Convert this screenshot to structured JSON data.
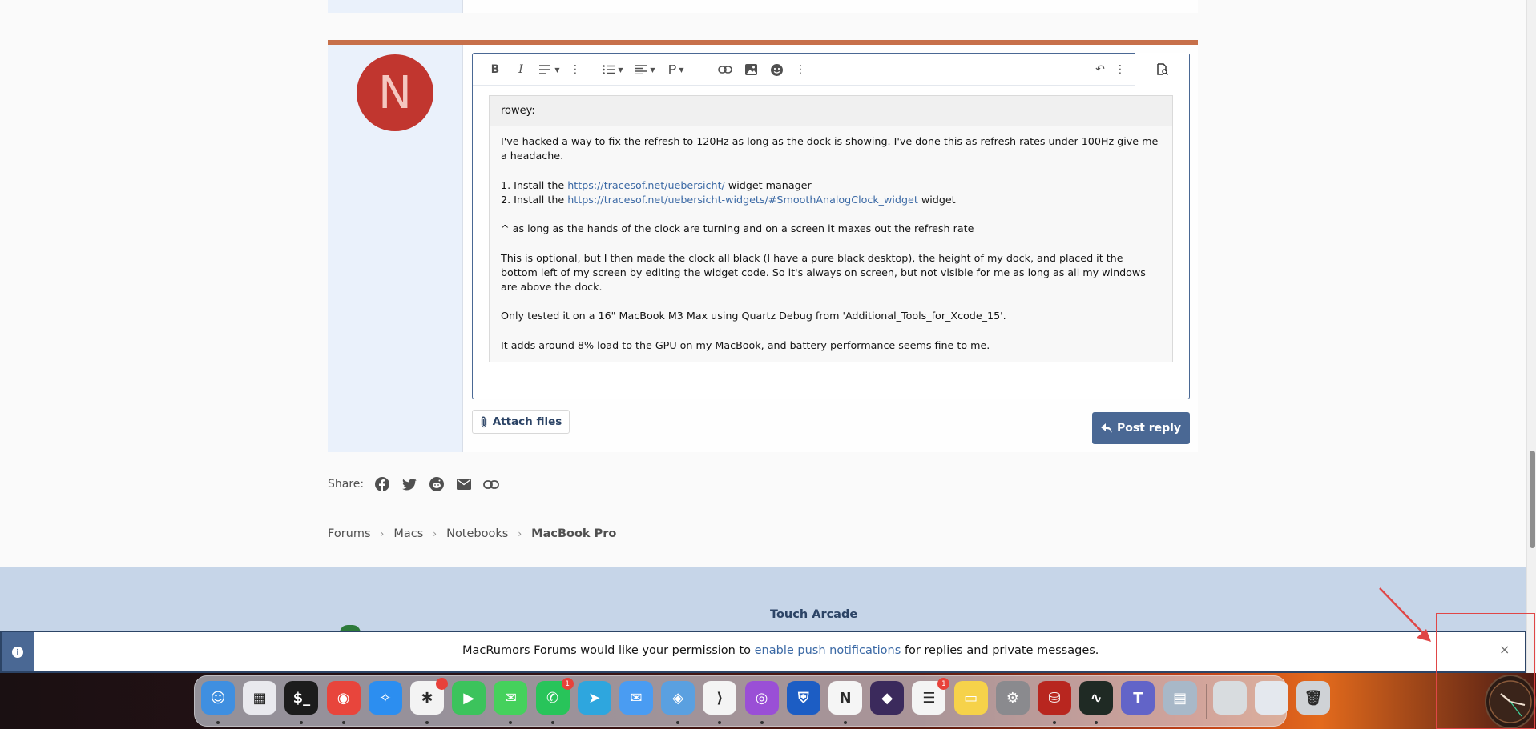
{
  "post": {
    "avatar_letter": "N",
    "quote_author": "rowey:",
    "paragraph1": "I've hacked a way to fix the refresh to 120Hz as long as the dock is showing. I've done this as refresh rates under 100Hz give me a headache.",
    "list": [
      {
        "prefix": "1. Install the ",
        "link": "https://tracesof.net/uebersicht/",
        "suffix": " widget manager"
      },
      {
        "prefix": "2. Install the ",
        "link": "https://tracesof.net/uebersicht-widgets/#SmoothAnalogClock_widget",
        "suffix": " widget"
      }
    ],
    "paragraph2": "^ as long as the hands of the clock are turning and on a screen it maxes out the refresh rate",
    "paragraph3": "This is optional, but I then made the clock all black (I have a pure black desktop), the height of my dock, and placed it the bottom left of my screen by editing the widget code. So it's always on screen, but not visible for me as long as all my windows are above the dock.",
    "paragraph4": "Only tested it on a 16\" MacBook M3 Max using Quartz Debug from 'Additional_Tools_for_Xcode_15'.",
    "paragraph5": "It adds around 8% load to the GPU on my MacBook, and battery performance seems fine to me.",
    "attach_label": "Attach files",
    "post_reply_label": "Post reply"
  },
  "toolbar": {
    "bold": "B",
    "italic": "I",
    "more": "⋮",
    "link": "🔗",
    "undo": "↶"
  },
  "share": {
    "label": "Share:"
  },
  "breadcrumb": {
    "items": [
      "Forums",
      "Macs",
      "Notebooks"
    ],
    "current": "MacBook Pro"
  },
  "footer": {
    "link": "Touch Arcade"
  },
  "notification": {
    "prefix": "MacRumors Forums would like your permission to ",
    "link": "enable push notifications",
    "suffix": " for replies and private messages.",
    "close": "×"
  },
  "dock": {
    "items": [
      {
        "name": "finder",
        "color": "#3f8fe0",
        "glyph": "☺",
        "dot": true
      },
      {
        "name": "launchpad",
        "color": "#e9e9ee",
        "glyph": "▦",
        "dot": false
      },
      {
        "name": "terminal",
        "color": "#1c1c1c",
        "glyph": "$_",
        "dot": true
      },
      {
        "name": "chrome",
        "color": "#e8453c",
        "glyph": "◉",
        "dot": true
      },
      {
        "name": "safari",
        "color": "#2c8ef0",
        "glyph": "✧",
        "dot": false
      },
      {
        "name": "slack",
        "color": "#f3f3f3",
        "glyph": "✱",
        "dot": true,
        "badge": ""
      },
      {
        "name": "facetime",
        "color": "#3cc35c",
        "glyph": "▶",
        "dot": false
      },
      {
        "name": "messages",
        "color": "#45d15c",
        "glyph": "✉",
        "dot": true
      },
      {
        "name": "whatsapp",
        "color": "#28c45a",
        "glyph": "✆",
        "dot": true,
        "badge": "1"
      },
      {
        "name": "telegram",
        "color": "#2ea6de",
        "glyph": "➤",
        "dot": false
      },
      {
        "name": "mail",
        "color": "#4a9cf2",
        "glyph": "✉",
        "dot": false
      },
      {
        "name": "preview",
        "color": "#5aa0e0",
        "glyph": "◈",
        "dot": true
      },
      {
        "name": "vscode",
        "color": "#f4f4f4",
        "glyph": "⟩",
        "dot": true
      },
      {
        "name": "ai-chat",
        "color": "#9a4fd6",
        "glyph": "◎",
        "dot": true
      },
      {
        "name": "bitwarden",
        "color": "#1c5dc4",
        "glyph": "⛨",
        "dot": false
      },
      {
        "name": "notion",
        "color": "#f5f5f5",
        "glyph": "N",
        "dot": true
      },
      {
        "name": "obsidian",
        "color": "#3b2a5c",
        "glyph": "◆",
        "dot": false
      },
      {
        "name": "reminders",
        "color": "#f4f4f4",
        "glyph": "☰",
        "dot": false,
        "badge": "1"
      },
      {
        "name": "notes",
        "color": "#f6d24a",
        "glyph": "▭",
        "dot": false
      },
      {
        "name": "system-settings",
        "color": "#8a8a8e",
        "glyph": "⚙",
        "dot": false
      },
      {
        "name": "database",
        "color": "#b8261f",
        "glyph": "⛁",
        "dot": true
      },
      {
        "name": "activity-monitor",
        "color": "#1f2a24",
        "glyph": "∿",
        "dot": true
      },
      {
        "name": "teams",
        "color": "#6264c8",
        "glyph": "T",
        "dot": false
      },
      {
        "name": "preview-docs",
        "color": "#a8b8c8",
        "glyph": "▤",
        "dot": false
      },
      {
        "name": "window-1",
        "color": "#d8dcdf",
        "glyph": "",
        "dot": false
      },
      {
        "name": "window-2",
        "color": "#e4e8ee",
        "glyph": "",
        "dot": false
      },
      {
        "name": "trash",
        "color": "#cfd2d6",
        "glyph": "🗑",
        "dot": false
      }
    ]
  }
}
